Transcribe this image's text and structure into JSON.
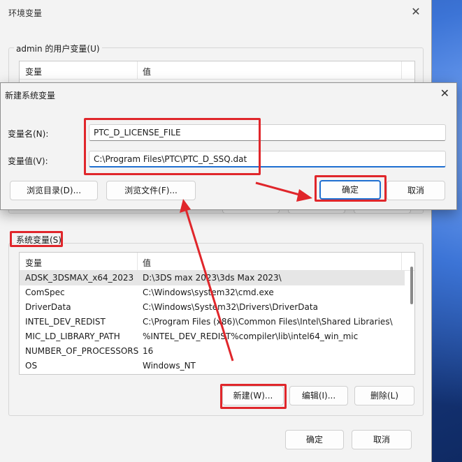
{
  "env_window": {
    "title": "环境变量",
    "user_group_label": "admin 的用户变量(U)",
    "user_columns": {
      "variable": "变量",
      "value": "值"
    },
    "system_group_label": "系统变量(S)",
    "system_columns": {
      "variable": "变量",
      "value": "值"
    },
    "system_rows": [
      {
        "name": "ADSK_3DSMAX_x64_2023",
        "value": "D:\\3DS max 2023\\3ds Max 2023\\"
      },
      {
        "name": "ComSpec",
        "value": "C:\\Windows\\system32\\cmd.exe"
      },
      {
        "name": "DriverData",
        "value": "C:\\Windows\\System32\\Drivers\\DriverData"
      },
      {
        "name": "INTEL_DEV_REDIST",
        "value": "C:\\Program Files (x86)\\Common Files\\Intel\\Shared Libraries\\"
      },
      {
        "name": "MIC_LD_LIBRARY_PATH",
        "value": "%INTEL_DEV_REDIST%compiler\\lib\\intel64_win_mic"
      },
      {
        "name": "NUMBER_OF_PROCESSORS",
        "value": "16"
      },
      {
        "name": "OS",
        "value": "Windows_NT"
      }
    ],
    "buttons": {
      "new": "新建(W)...",
      "edit": "编辑(I)...",
      "delete": "删除(L)",
      "ok": "确定",
      "cancel": "取消"
    }
  },
  "new_dialog": {
    "title": "新建系统变量",
    "name_label": "变量名(N):",
    "name_value": "PTC_D_LICENSE_FILE",
    "value_label": "变量值(V):",
    "value_value": "C:\\Program Files\\PTC\\PTC_D_SSQ.dat",
    "buttons": {
      "browse_dir": "浏览目录(D)...",
      "browse_file": "浏览文件(F)...",
      "ok": "确定",
      "cancel": "取消"
    }
  },
  "colors": {
    "annotation": "#e0262b",
    "accent": "#1f6fd1"
  }
}
